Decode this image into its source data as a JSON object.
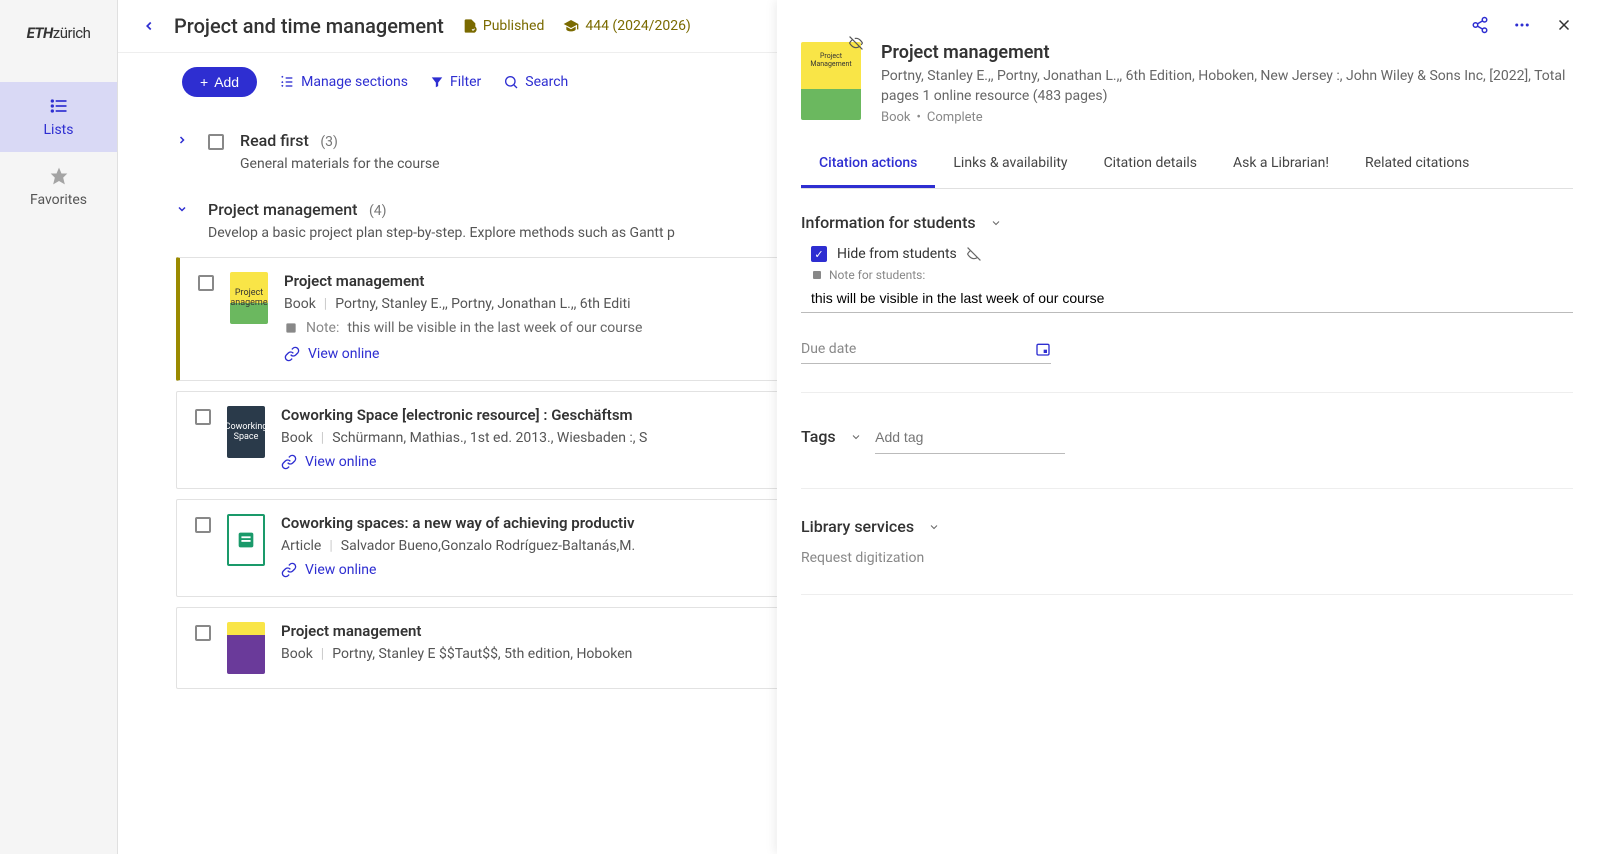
{
  "brand": {
    "bold": "ETH",
    "light": "zürich"
  },
  "nav": {
    "lists": "Lists",
    "favorites": "Favorites"
  },
  "header": {
    "title": "Project and time management",
    "published": "Published",
    "term": "444 (2024/2026)"
  },
  "toolbar": {
    "add": "Add",
    "manage": "Manage sections",
    "filter": "Filter",
    "search": "Search"
  },
  "sections": [
    {
      "title": "Read first",
      "count": "(3)",
      "desc": "General materials for the course",
      "expanded": false,
      "items": []
    },
    {
      "title": "Project management",
      "count": "(4)",
      "desc": "Develop a basic project plan step-by-step. Explore methods such as Gantt p",
      "expanded": true,
      "items": [
        {
          "title": "Project management",
          "type": "Book",
          "meta": "Portny, Stanley E.,, Portny, Jonathan L.,, 6th Editi",
          "note": "this will be visible in the last week of our course",
          "view": "View online",
          "thumb": "yellow",
          "selected": true
        },
        {
          "title": "Coworking Space [electronic resource] : Geschäftsm",
          "type": "Book",
          "meta": "Schürmann, Mathias., 1st ed. 2013., Wiesbaden :, S",
          "view": "View online",
          "thumb": "dark"
        },
        {
          "title": "Coworking spaces: a new way of achieving productiv",
          "type": "Article",
          "meta": "Salvador Bueno,Gonzalo Rodríguez-Baltanás,M.",
          "view": "View online",
          "thumb": "green"
        },
        {
          "title": "Project management",
          "type": "Book",
          "meta": "Portny, Stanley E $$Taut$$, 5th edition, Hoboken",
          "thumb": "purple"
        }
      ]
    }
  ],
  "detail": {
    "title": "Project management",
    "citation": "Portny, Stanley E.,, Portny, Jonathan L.,, 6th Edition, Hoboken, New Jersey :, John Wiley & Sons Inc, [2022], Total pages 1 online resource (483 pages)",
    "type": "Book",
    "status": "Complete",
    "tabs": {
      "citation_actions": "Citation actions",
      "links": "Links & availability",
      "details": "Citation details",
      "ask": "Ask a Librarian!",
      "related": "Related citations"
    },
    "info_heading": "Information for students",
    "hide_label": "Hide from students",
    "note_label": "Note for students:",
    "note_value": "this will be visible in the last week of our course",
    "due_label": "Due date",
    "tags_heading": "Tags",
    "add_tag": "Add tag",
    "library_heading": "Library services",
    "library_text": "Request digitization"
  },
  "labels": {
    "note": "Note:"
  }
}
